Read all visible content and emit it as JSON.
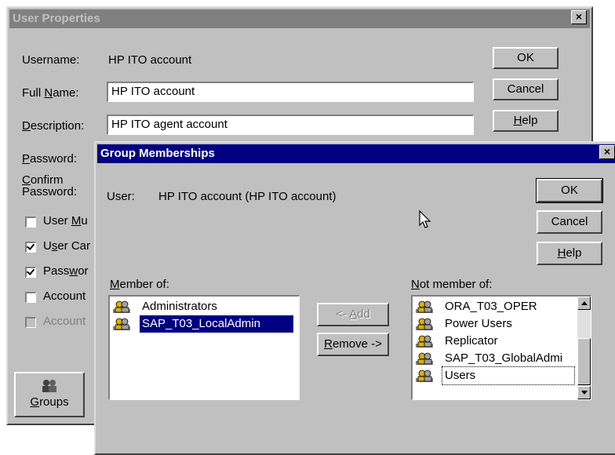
{
  "user_properties": {
    "title": "User Properties",
    "close_glyph": "×",
    "username_label": "Username:",
    "username_value": "HP ITO account",
    "fullname_label_pre": "Full ",
    "fullname_label_key": "N",
    "fullname_label_post": "ame:",
    "fullname_value": "HP ITO account",
    "description_label_key": "D",
    "description_label_post": "escription:",
    "description_value": "HP ITO agent account",
    "password_label_key": "P",
    "password_label_post": "assword:",
    "confirm_label_key": "C",
    "confirm_label_line1_post": "onfirm",
    "confirm_label_line2": "Password:",
    "ok_label": "OK",
    "cancel_label": "Cancel",
    "help_label_key": "H",
    "help_label_post": "elp",
    "checkboxes": [
      {
        "pre": "User ",
        "key": "M",
        "post": "u",
        "checked": false
      },
      {
        "pre": "U",
        "key": "s",
        "post": "er Car",
        "checked": true
      },
      {
        "pre": "Pass",
        "key": "w",
        "post": "or",
        "checked": true
      },
      {
        "pre": "Account",
        "key": "",
        "post": "",
        "checked": false
      },
      {
        "pre": "Account",
        "key": "",
        "post": "",
        "checked": false,
        "disabled": true
      }
    ],
    "groups_button_key": "G",
    "groups_button_post": "roups",
    "groups_icon": "groups-icon"
  },
  "group_memberships": {
    "title": "Group Memberships",
    "close_glyph": "×",
    "user_label": "User:",
    "user_value": "HP ITO account (HP ITO account)",
    "ok_label": "OK",
    "cancel_label": "Cancel",
    "help_label_key": "H",
    "help_label_post": "elp",
    "member_of_label_key": "M",
    "member_of_label_post": "ember of:",
    "not_member_of_label_key": "N",
    "not_member_of_label_post": "ot member of:",
    "add_label_pre": "<- ",
    "add_label_key": "A",
    "add_label_post": "dd",
    "remove_label_key": "R",
    "remove_label_post": "emove ->",
    "member_of": [
      {
        "name": "Administrators",
        "selected": false
      },
      {
        "name": "SAP_T03_LocalAdmin",
        "selected": true
      }
    ],
    "not_member_of": [
      {
        "name": "ORA_T03_OPER"
      },
      {
        "name": "Power Users"
      },
      {
        "name": "Replicator"
      },
      {
        "name": "SAP_T03_GlobalAdmi"
      },
      {
        "name": "Users",
        "focused": true
      }
    ],
    "group_icon": "group-icon"
  }
}
